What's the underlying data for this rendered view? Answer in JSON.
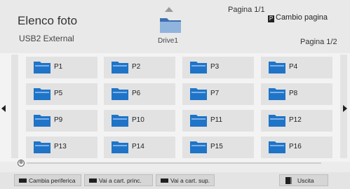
{
  "header": {
    "title": "Elenco foto",
    "device": "USB2 External",
    "drive_label": "Drive1",
    "page_indicator_top": "Pagina 1/1",
    "page_change_label": "Cambio pagina",
    "page_change_key": "P",
    "page_indicator_right": "Pagina 1/2"
  },
  "folders": [
    {
      "label": "P1"
    },
    {
      "label": "P2"
    },
    {
      "label": "P3"
    },
    {
      "label": "P4"
    },
    {
      "label": "P5"
    },
    {
      "label": "P6"
    },
    {
      "label": "P7"
    },
    {
      "label": "P8"
    },
    {
      "label": "P9"
    },
    {
      "label": "P10"
    },
    {
      "label": "P11"
    },
    {
      "label": "P12"
    },
    {
      "label": "P13"
    },
    {
      "label": "P14"
    },
    {
      "label": "P15"
    },
    {
      "label": "P16"
    }
  ],
  "scroll": {
    "icon": "scroll-icon",
    "symbol": "⊕"
  },
  "footer": {
    "change_device": "Cambia periferica",
    "go_home_folder": "Vai a cart. princ.",
    "go_up_folder": "Vai a cart. sup.",
    "exit": "Uscita"
  },
  "colors": {
    "folder_blue": "#1f74c7",
    "folder_light": "#7fb2ea",
    "tile_bg": "#e2e2e2"
  }
}
